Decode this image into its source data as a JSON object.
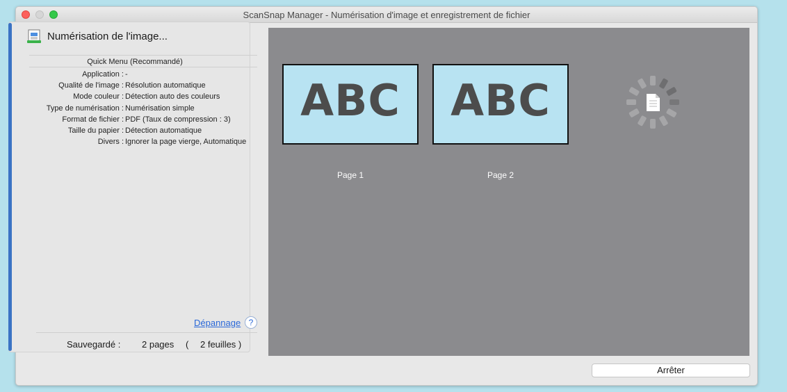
{
  "window": {
    "title": "ScanSnap Manager - Numérisation d'image et enregistrement de fichier"
  },
  "status": {
    "heading": "Numérisation de l'image...",
    "menu_title": "Quick Menu (Recommandé)",
    "settings": [
      {
        "label": "Application :",
        "value": "-"
      },
      {
        "label": "Qualité de l'image :",
        "value": "Résolution automatique"
      },
      {
        "label": "Mode couleur :",
        "value": "Détection auto des couleurs"
      },
      {
        "label": "Type de numérisation :",
        "value": "Numérisation simple"
      },
      {
        "label": "Format de fichier :",
        "value": "PDF (Taux de compression : 3)"
      },
      {
        "label": "Taille du papier :",
        "value": "Détection automatique"
      },
      {
        "label": "Divers :",
        "value": "Ignorer la page vierge, Automatique"
      }
    ],
    "help_link": "Dépannage",
    "help_icon_glyph": "?",
    "saved_label": "Sauvegardé :",
    "saved_pages": "2 pages",
    "open_paren": "(",
    "saved_sheets": "2 feuilles )"
  },
  "preview": {
    "pages": [
      {
        "content": "ABC",
        "label": "Page 1"
      },
      {
        "content": "ABC",
        "label": "Page 2"
      }
    ]
  },
  "footer": {
    "stop_label": "Arrêter"
  },
  "colors": {
    "accent_bar": "#3a73c4",
    "preview_bg": "#8b8b8e",
    "thumb_bg": "#b8e3f2",
    "link": "#2a68d8"
  },
  "icons": {
    "header": "scanner-document-icon",
    "spinner": "progress-spinner-icon"
  }
}
